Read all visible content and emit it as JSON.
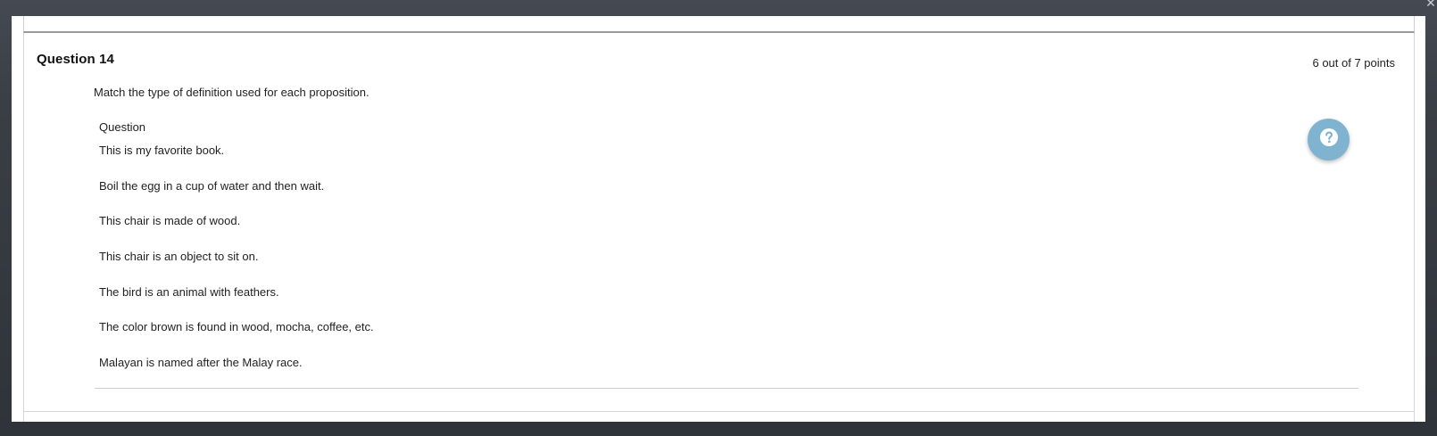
{
  "question": {
    "title": "Question 14",
    "points": "6 out of 7 points",
    "prompt": "Match the type of definition used for each proposition.",
    "column_header": "Question",
    "items": [
      "This is my favorite book.",
      "Boil the egg in a cup of water and then wait.",
      "This chair is made of wood.",
      "This chair is an object to sit on.",
      "The bird is an animal with feathers.",
      "The color brown is found in  wood, mocha, coffee, etc.",
      "Malayan is named after the Malay race."
    ]
  },
  "icons": {
    "help": "question-circle-icon",
    "close": "close-icon"
  },
  "colors": {
    "help_button": "#7fb3cf",
    "backdrop": "#3b3f46"
  }
}
